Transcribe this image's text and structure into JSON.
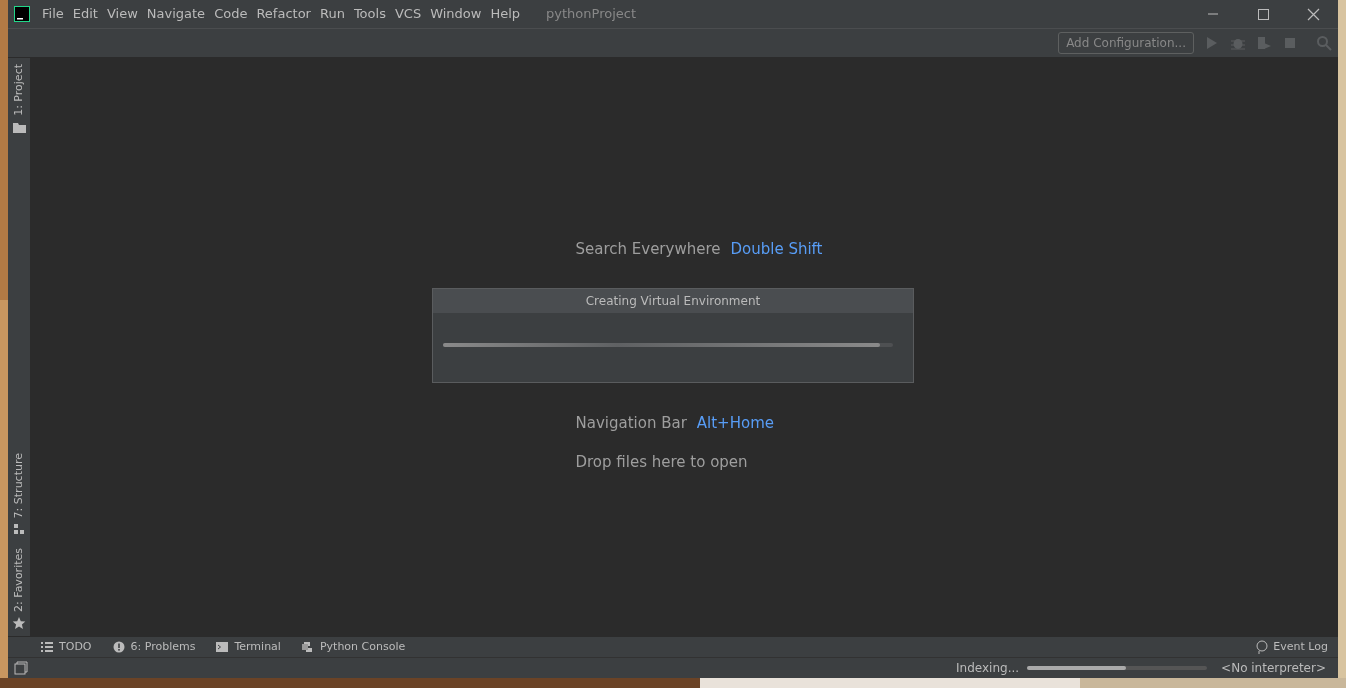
{
  "window": {
    "title": "pythonProject"
  },
  "menu": [
    "File",
    "Edit",
    "View",
    "Navigate",
    "Code",
    "Refactor",
    "Run",
    "Tools",
    "VCS",
    "Window",
    "Help"
  ],
  "toolbar": {
    "configuration": "Add Configuration..."
  },
  "left_stripe_top": [
    {
      "label": "1: Project",
      "kind": "folder"
    }
  ],
  "left_stripe_bottom": [
    {
      "label": "7: Structure",
      "kind": "structure"
    },
    {
      "label": "2: Favorites",
      "kind": "star"
    }
  ],
  "hints": [
    {
      "label": "Search Everywhere",
      "shortcut": "Double Shift"
    },
    {
      "label": "Navigation Bar",
      "shortcut": "Alt+Home"
    },
    {
      "label": "Drop files here to open"
    }
  ],
  "dialog": {
    "title": "Creating Virtual Environment",
    "level": 0.97
  },
  "bottom_tools": [
    {
      "label": "TODO",
      "kind": "list"
    },
    {
      "label": "6: Problems",
      "kind": "problems"
    },
    {
      "label": "Terminal",
      "kind": "terminal"
    },
    {
      "label": "Python Console",
      "kind": "python"
    }
  ],
  "event_log": "Event Log",
  "status_bar": {
    "task": "Indexing...",
    "level": 0.55,
    "interpreter": "<No interpreter>"
  }
}
